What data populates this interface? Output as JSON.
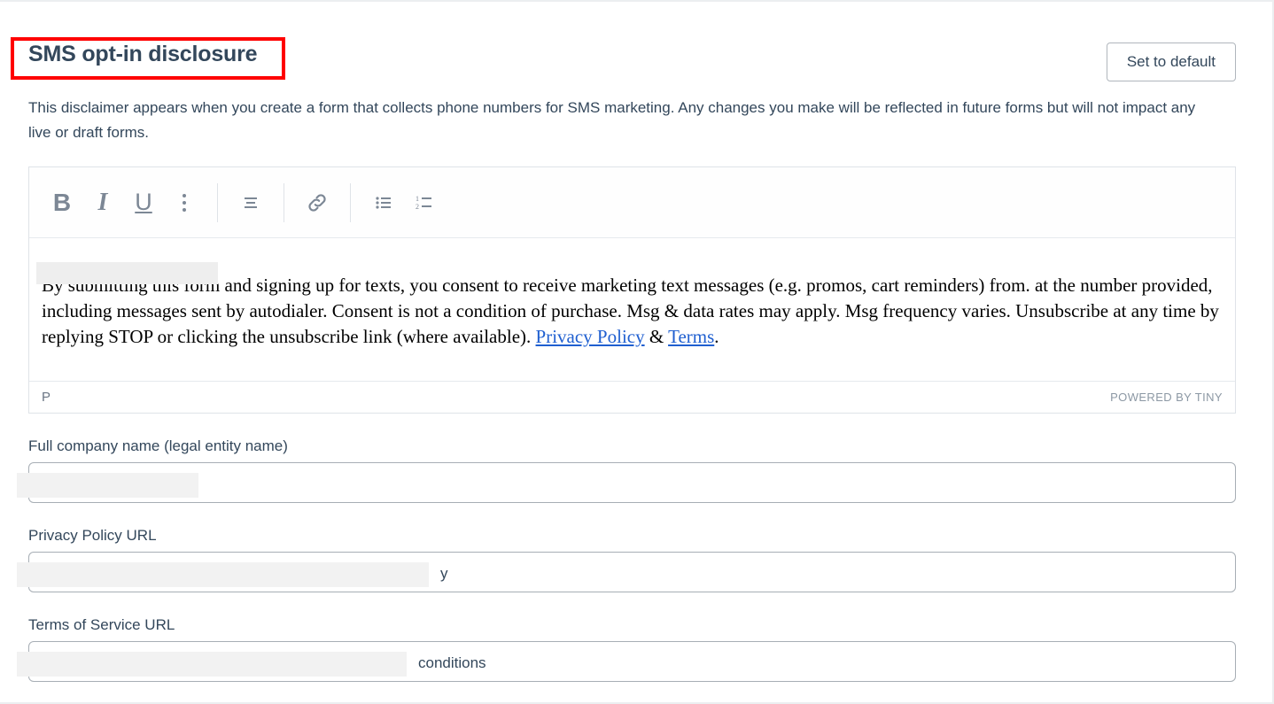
{
  "page": {
    "title": "SMS opt-in disclosure",
    "description": "This disclaimer appears when you create a form that collects phone numbers for SMS marketing. Any changes you make will be reflected in future forms but will not impact any live or draft forms."
  },
  "header": {
    "set_to_default_label": "Set to default"
  },
  "annotation": {
    "color": "#ff0000",
    "target": "page-title"
  },
  "editor": {
    "toolbar": [
      {
        "name": "bold-icon",
        "glyph": "B",
        "label": "Bold"
      },
      {
        "name": "italic-icon",
        "glyph": "I",
        "label": "Italic"
      },
      {
        "name": "underline-icon",
        "glyph": "U",
        "label": "Underline"
      },
      {
        "name": "more-options-icon",
        "glyph": "⋮",
        "label": "More formats"
      },
      {
        "name": "align-icon",
        "glyph": "≡",
        "label": "Alignment"
      },
      {
        "name": "link-icon",
        "glyph": "🔗",
        "label": "Insert link"
      },
      {
        "name": "bullet-list-icon",
        "glyph": "•≡",
        "label": "Bullet list"
      },
      {
        "name": "numbered-list-icon",
        "glyph": "1≡",
        "label": "Numbered list"
      }
    ],
    "body": {
      "segment_1": "By submitting this form and signing up for texts, you consent to receive marketing text messages (e.g. promos, cart reminders) from",
      "redacted_company": "",
      "segment_2": ". at the number provided, including messages sent by autodialer. Consent is not a condition of purchase. Msg & data rates may apply. Msg frequency varies. Unsubscribe at any time by replying STOP or clicking the unsubscribe link (where available). ",
      "link_privacy": "Privacy Policy",
      "separator": " & ",
      "link_terms": "Terms",
      "period": "."
    },
    "status": {
      "element_path": "P",
      "branding": "POWERED BY TINY"
    }
  },
  "fields": [
    {
      "label": "Full company name (legal entity name)",
      "value_visible": ".",
      "redacted": true
    },
    {
      "label": "Privacy Policy URL",
      "value_visible": "y",
      "redacted": true
    },
    {
      "label": "Terms of Service URL",
      "value_visible": "conditions",
      "redacted": true
    }
  ],
  "colors": {
    "text": "#33475b",
    "link": "#1f5fd0",
    "annotation": "#ff0000",
    "border": "#dfe3e8"
  }
}
